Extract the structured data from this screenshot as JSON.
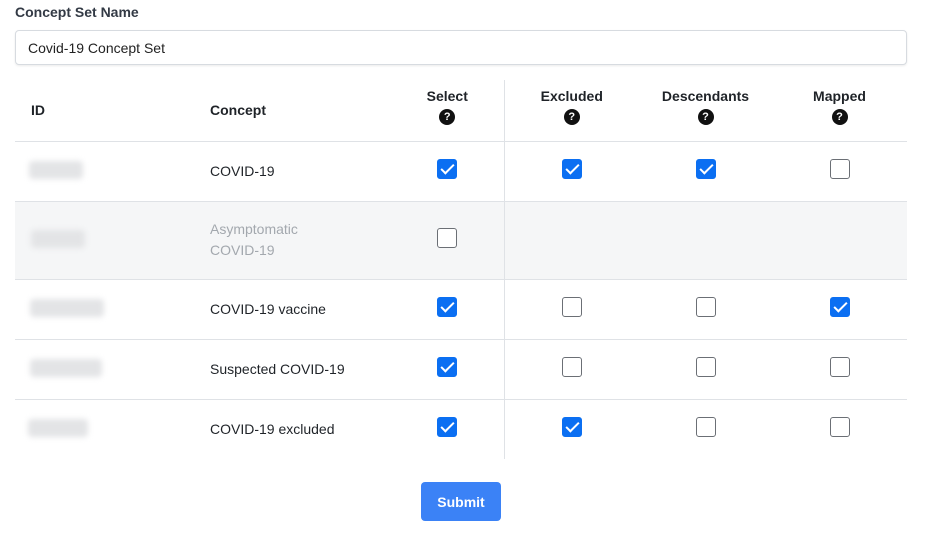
{
  "form": {
    "name_label": "Concept Set Name",
    "name_value": "Covid-19 Concept Set"
  },
  "table": {
    "headers": {
      "id": "ID",
      "concept": "Concept",
      "select": "Select",
      "excluded": "Excluded",
      "descendants": "Descendants",
      "mapped": "Mapped"
    },
    "help_icon_glyph": "?",
    "rows": [
      {
        "concept": "COVID-19",
        "select": true,
        "excluded": true,
        "descendants": true,
        "mapped": false,
        "disabled": false
      },
      {
        "concept": "Asymptomatic COVID-19",
        "select": false,
        "excluded": null,
        "descendants": null,
        "mapped": null,
        "disabled": true
      },
      {
        "concept": "COVID-19 vaccine",
        "select": true,
        "excluded": false,
        "descendants": false,
        "mapped": true,
        "disabled": false
      },
      {
        "concept": "Suspected COVID-19",
        "select": true,
        "excluded": false,
        "descendants": false,
        "mapped": false,
        "disabled": false
      },
      {
        "concept": "COVID-19 excluded",
        "select": true,
        "excluded": true,
        "descendants": false,
        "mapped": false,
        "disabled": false
      }
    ]
  },
  "actions": {
    "submit_label": "Submit"
  },
  "colors": {
    "accent": "#3b82f6",
    "checkbox_checked": "#0b6ff2"
  }
}
